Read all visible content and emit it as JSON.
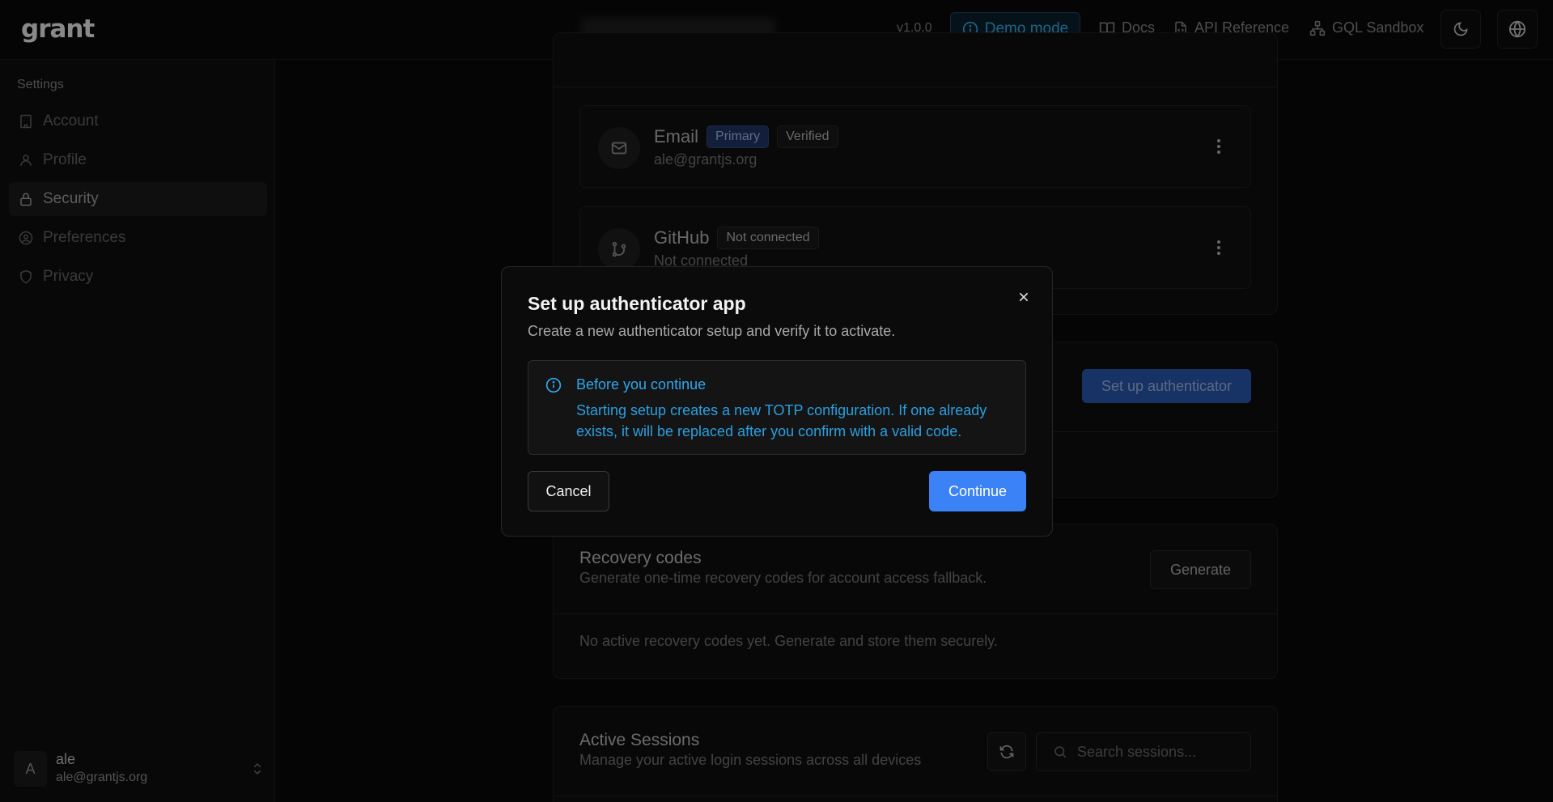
{
  "app": {
    "logo_text": "grant"
  },
  "header": {
    "version": "v1.0.0",
    "demo_mode_label": "Demo mode",
    "links": [
      {
        "label": "Docs",
        "icon": "book-icon"
      },
      {
        "label": "API Reference",
        "icon": "file-code-icon"
      },
      {
        "label": "GQL Sandbox",
        "icon": "network-icon"
      }
    ],
    "theme_toggle_icon": "moon-icon",
    "language_icon": "globe-icon"
  },
  "sidebar": {
    "heading": "Settings",
    "items": [
      {
        "label": "Account",
        "icon": "building-icon",
        "active": false
      },
      {
        "label": "Profile",
        "icon": "user-icon",
        "active": false
      },
      {
        "label": "Security",
        "icon": "lock-icon",
        "active": true
      },
      {
        "label": "Preferences",
        "icon": "user-circle-icon",
        "active": false
      },
      {
        "label": "Privacy",
        "icon": "shield-icon",
        "active": false
      }
    ],
    "user": {
      "initial": "A",
      "name": "ale",
      "email": "ale@grantjs.org"
    }
  },
  "main": {
    "connections": [
      {
        "title": "Email",
        "badges": [
          "Primary",
          "Verified"
        ],
        "subtitle": "ale@grantjs.org",
        "icon": "mail-icon"
      },
      {
        "title": "GitHub",
        "badges": [
          "Not connected"
        ],
        "subtitle": "Not connected",
        "icon": "git-branch-icon"
      }
    ],
    "authenticator": {
      "button_label": "Set up authenticator"
    },
    "recovery": {
      "title": "Recovery codes",
      "description": "Generate one-time recovery codes for account access fallback.",
      "button_label": "Generate",
      "empty_text": "No active recovery codes yet. Generate and store them securely."
    },
    "sessions": {
      "title": "Active Sessions",
      "description": "Manage your active login sessions across all devices",
      "search_placeholder": "Search sessions..."
    }
  },
  "dialog": {
    "title": "Set up authenticator app",
    "description": "Create a new authenticator setup and verify it to activate.",
    "alert": {
      "title": "Before you continue",
      "body": "Starting setup creates a new TOTP configuration. If one already exists, it will be replaced after you confirm with a valid code."
    },
    "cancel_label": "Cancel",
    "continue_label": "Continue"
  },
  "colors": {
    "accent": "#3b82f6",
    "info": "#2ea8ee",
    "background": "#0a0a0a"
  }
}
